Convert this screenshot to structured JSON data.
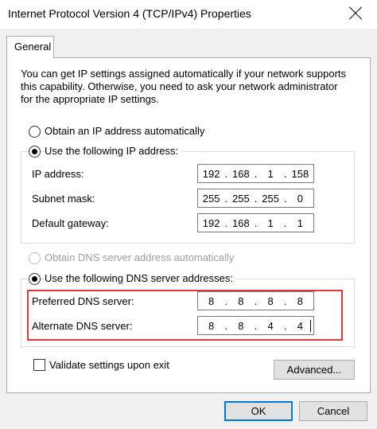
{
  "window": {
    "title": "Internet Protocol Version 4 (TCP/IPv4) Properties"
  },
  "tabs": [
    {
      "label": "General"
    }
  ],
  "description": [
    "You can get IP settings assigned automatically if your network supports",
    "this capability. Otherwise, you need to ask your network administrator",
    "for the appropriate IP settings."
  ],
  "ip_section": {
    "auto_label": "Obtain an IP address automatically",
    "manual_label": "Use the following IP address:",
    "fields": [
      {
        "label": "IP address:",
        "octets": [
          "192",
          "168",
          "1",
          "158"
        ]
      },
      {
        "label": "Subnet mask:",
        "octets": [
          "255",
          "255",
          "255",
          "0"
        ]
      },
      {
        "label": "Default gateway:",
        "octets": [
          "192",
          "168",
          "1",
          "1"
        ]
      }
    ]
  },
  "dns_section": {
    "auto_label": "Obtain DNS server address automatically",
    "manual_label": "Use the following DNS server addresses:",
    "fields": [
      {
        "label": "Preferred DNS server:",
        "octets": [
          "8",
          "8",
          "8",
          "8"
        ]
      },
      {
        "label": "Alternate DNS server:",
        "octets": [
          "8",
          "8",
          "4",
          "4"
        ]
      }
    ]
  },
  "validate_label": "Validate settings upon exit",
  "buttons": {
    "advanced": "Advanced...",
    "ok": "OK",
    "cancel": "Cancel"
  },
  "colors": {
    "highlight": "#e23939",
    "default_button_border": "#0078d7"
  }
}
